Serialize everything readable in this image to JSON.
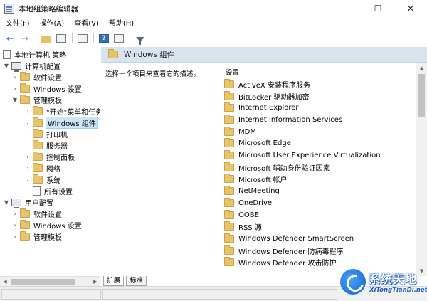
{
  "window": {
    "title": "本地组策略编辑器",
    "minimize": "—",
    "maximize": "☐",
    "close": "✕"
  },
  "menu": [
    "文件(F)",
    "操作(A)",
    "查看(V)",
    "帮助(H)"
  ],
  "toolbar": {
    "back": "←",
    "forward": "→",
    "help": "?"
  },
  "tree": {
    "root": "本地计算机 策略",
    "computer_config": "计算机配置",
    "software_settings": "软件设置",
    "windows_settings": "Windows 设置",
    "admin_templates": "管理模板",
    "start_menu": "\"开始\"菜单和任务栏",
    "windows_components": "Windows 组件",
    "printers": "打印机",
    "servers": "服务器",
    "control_panel": "控制面板",
    "network": "网络",
    "system": "系统",
    "all_settings": "所有设置",
    "user_config": "用户配置",
    "user_software_settings": "软件设置",
    "user_windows_settings": "Windows 设置",
    "user_admin_templates": "管理模板"
  },
  "details": {
    "header_title": "Windows 组件",
    "description": "选择一个项目来查看它的描述。",
    "column_header": "设置",
    "items": [
      "ActiveX 安装程序服务",
      "BitLocker 驱动器加密",
      "Internet Explorer",
      "Internet Information Services",
      "MDM",
      "Microsoft Edge",
      "Microsoft User Experience Virtualization",
      "Microsoft 辅助身份验证因素",
      "Microsoft 帐户",
      "NetMeeting",
      "OneDrive",
      "OOBE",
      "RSS 源",
      "Windows Defender SmartScreen",
      "Windows Defender 防病毒程序",
      "Windows Defender 攻击防护"
    ]
  },
  "tabs": [
    "扩展",
    "标准"
  ],
  "watermark": {
    "title": "系统天地",
    "url": "XiTongTianDi.net"
  }
}
